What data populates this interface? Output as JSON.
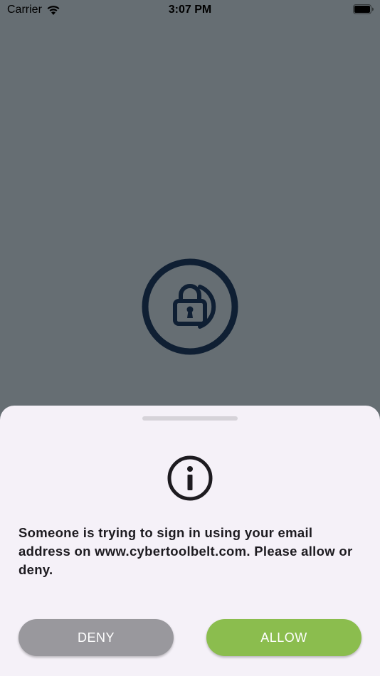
{
  "status_bar": {
    "carrier": "Carrier",
    "time": "3:07 PM"
  },
  "sheet": {
    "message": "Someone is trying to sign in using your email address on www.cybertoolbelt.com. Please allow or deny.",
    "deny_label": "DENY",
    "allow_label": "ALLOW"
  },
  "colors": {
    "background_overlay": "#666e73",
    "sheet_background": "#f5f1f8",
    "deny_button": "#99989d",
    "allow_button": "#8bbd4e",
    "logo": "#0f1f33"
  },
  "icons": {
    "status": [
      "wifi-icon",
      "battery-icon"
    ],
    "center": "lock-logo-icon",
    "sheet": "info-icon"
  }
}
